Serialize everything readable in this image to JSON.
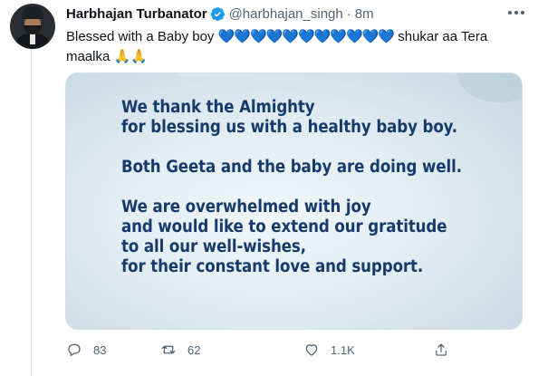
{
  "tweet": {
    "author_name": "Harbhajan Turbanator",
    "handle": "@harbhajan_singh",
    "separator": "·",
    "time": "8m",
    "text_before": "Blessed with a Baby boy",
    "hearts": "💙💙💙💙💙💙💙💙💙💙💙",
    "text_after": "shukar aa Tera maalka",
    "hands": "🙏🙏"
  },
  "media": {
    "lines": [
      "We thank the Almighty",
      "for blessing us with a healthy baby boy.",
      "Both Geeta and the baby are doing well.",
      "We are overwhelmed with joy",
      "and would like to extend our gratitude",
      "to all our well-wishes,",
      "for their constant love and support."
    ]
  },
  "actions": {
    "replies": "83",
    "retweets": "62",
    "likes": "1.1K"
  },
  "icons": {
    "verified": "verified-badge-icon",
    "more": "more-options-icon",
    "reply": "reply-icon",
    "retweet": "retweet-icon",
    "like": "heart-icon",
    "share": "share-icon"
  },
  "colors": {
    "verified": "#1d9bf0",
    "card_text": "#163a6b",
    "muted": "#536471"
  }
}
